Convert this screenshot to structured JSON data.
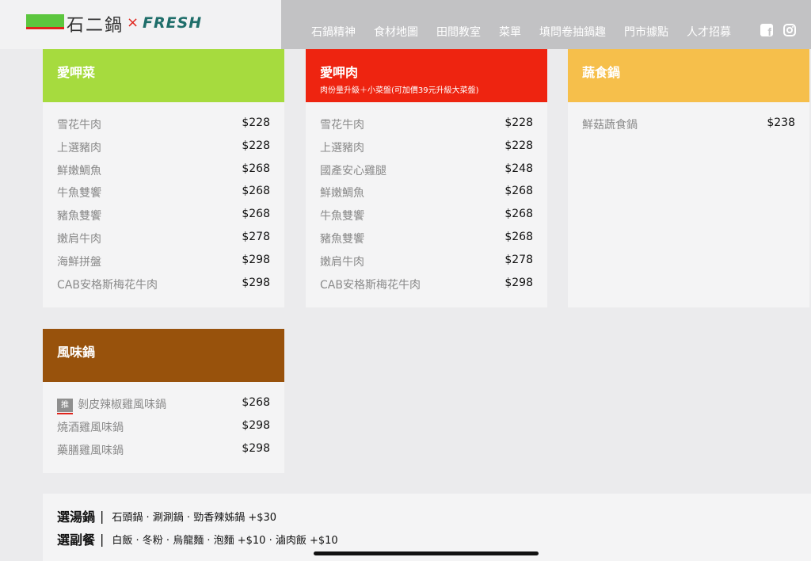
{
  "header": {
    "brand": "石二鍋",
    "x": "×",
    "fresh": "FRESH",
    "nav": [
      "石鍋精神",
      "食材地圖",
      "田間教室",
      "菜單",
      "填問卷抽鍋趣",
      "門市據點",
      "人才招募"
    ],
    "fb_glyph": "f"
  },
  "cards": {
    "veg": {
      "title": "愛呷菜",
      "color": "#a6db3e",
      "items": [
        {
          "name": "雪花牛肉",
          "price": "$228"
        },
        {
          "name": "上選豬肉",
          "price": "$228"
        },
        {
          "name": "鮮嫩鯛魚",
          "price": "$268"
        },
        {
          "name": "牛魚雙饗",
          "price": "$268"
        },
        {
          "name": "豬魚雙饗",
          "price": "$268"
        },
        {
          "name": "嫩肩牛肉",
          "price": "$278"
        },
        {
          "name": "海鮮拼盤",
          "price": "$298"
        },
        {
          "name": "CAB安格斯梅花牛肉",
          "price": "$298"
        }
      ]
    },
    "meat": {
      "title": "愛呷肉",
      "subtitle": "肉份量升級＋小菜盤(可加價39元升級大菜盤)",
      "color": "#ee2410",
      "items": [
        {
          "name": "雪花牛肉",
          "price": "$228"
        },
        {
          "name": "上選豬肉",
          "price": "$228"
        },
        {
          "name": "國產安心雞腿",
          "price": "$248"
        },
        {
          "name": "鮮嫩鯛魚",
          "price": "$268"
        },
        {
          "name": "牛魚雙饗",
          "price": "$268"
        },
        {
          "name": "豬魚雙饗",
          "price": "$268"
        },
        {
          "name": "嫩肩牛肉",
          "price": "$278"
        },
        {
          "name": "CAB安格斯梅花牛肉",
          "price": "$298"
        }
      ]
    },
    "vegan": {
      "title": "蔬食鍋",
      "color": "#f6bf4b",
      "items": [
        {
          "name": "鮮菇蔬食鍋",
          "price": "$238"
        }
      ]
    },
    "flavor": {
      "title": "風味鍋",
      "color": "#98520c",
      "badge": "推",
      "items": [
        {
          "name": "剝皮辣椒雞風味鍋",
          "price": "$268"
        },
        {
          "name": "燒酒雞風味鍋",
          "price": "$298"
        },
        {
          "name": "藥膳雞風味鍋",
          "price": "$298"
        }
      ]
    }
  },
  "bottom": {
    "soup_label": "選湯鍋",
    "soup_value": "石頭鍋 · 涮涮鍋 · 勁香辣姊鍋 +$30",
    "side_label": "選副餐",
    "side_value": "白飯 · 冬粉 · 烏龍麵 · 泡麵 +$10 · 滷肉飯 +$10",
    "sep": "|"
  }
}
